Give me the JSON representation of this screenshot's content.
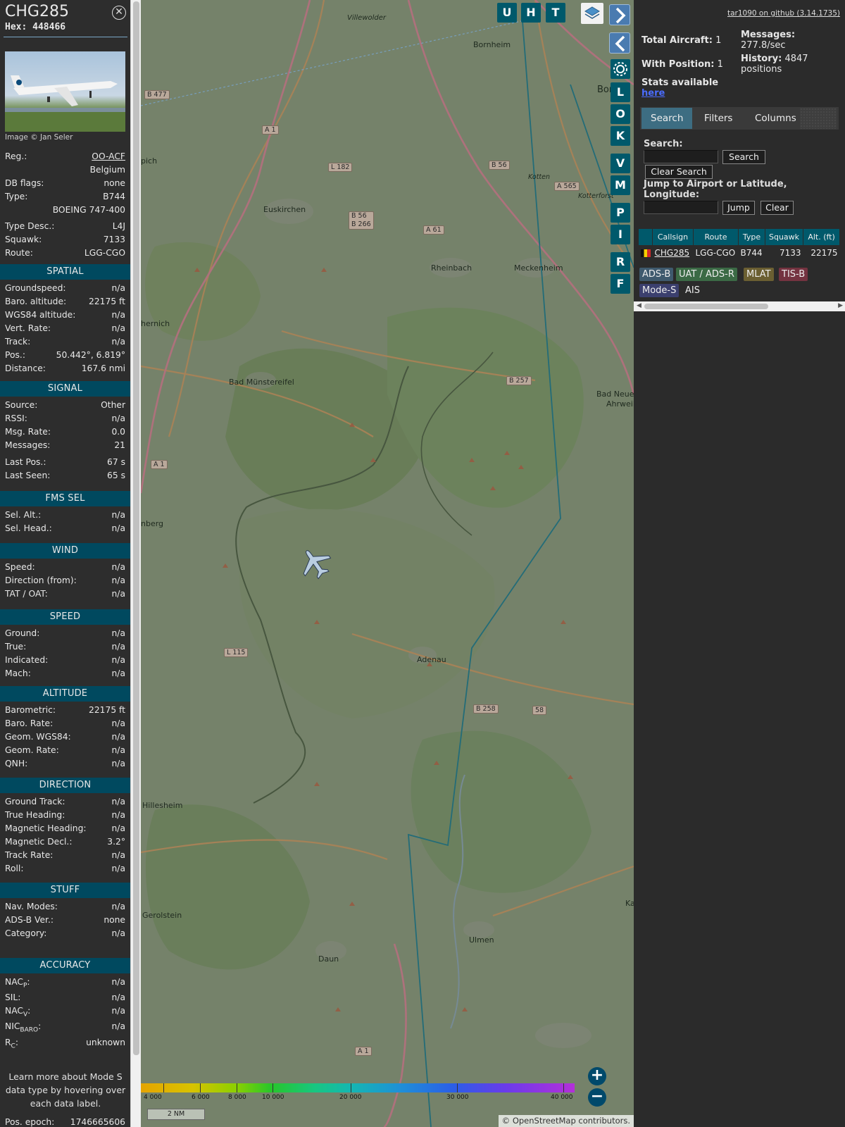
{
  "aircraft": {
    "callsign": "CHG285",
    "hex_label": "Hex:",
    "hex": "448466",
    "image_credit": "Image © Jan Seler"
  },
  "details": [
    {
      "label": "Reg.:",
      "value": "OO-ACF"
    },
    {
      "label": "",
      "value": "Belgium"
    },
    {
      "label": "DB flags:",
      "value": "none"
    },
    {
      "label": "Type:",
      "value": "B744"
    },
    {
      "label": "",
      "value": "BOEING 747-400"
    },
    {
      "label": "Type Desc.:",
      "value": "L4J"
    },
    {
      "label": "Squawk:",
      "value": "7133"
    },
    {
      "label": "Route:",
      "value": "LGG-CGO"
    }
  ],
  "sections": [
    {
      "title": "SPATIAL",
      "rows": [
        {
          "label": "Groundspeed:",
          "value": "n/a"
        },
        {
          "label": "Baro. altitude:",
          "value": "22175 ft"
        },
        {
          "label": "WGS84 altitude:",
          "value": "n/a"
        },
        {
          "label": "Vert. Rate:",
          "value": "n/a"
        },
        {
          "label": "Track:",
          "value": "n/a"
        },
        {
          "label": "Pos.:",
          "value": "50.442°, 6.819°"
        },
        {
          "label": "Distance:",
          "value": "167.6 nmi"
        }
      ]
    },
    {
      "title": "SIGNAL",
      "rows": [
        {
          "label": "Source:",
          "value": "Other"
        },
        {
          "label": "RSSI:",
          "value": "n/a"
        },
        {
          "label": "Msg. Rate:",
          "value": "0.0"
        },
        {
          "label": "Messages:",
          "value": "21"
        },
        {
          "label": "Last Pos.:",
          "value": "67 s"
        },
        {
          "label": "Last Seen:",
          "value": "65 s"
        }
      ]
    },
    {
      "title": "FMS SEL",
      "rows": [
        {
          "label": "Sel. Alt.:",
          "value": "n/a"
        },
        {
          "label": "Sel. Head.:",
          "value": "n/a"
        }
      ]
    },
    {
      "title": "WIND",
      "rows": [
        {
          "label": "Speed:",
          "value": "n/a"
        },
        {
          "label": "Direction (from):",
          "value": "n/a"
        },
        {
          "label": "TAT / OAT:",
          "value": "n/a"
        }
      ]
    },
    {
      "title": "SPEED",
      "rows": [
        {
          "label": "Ground:",
          "value": "n/a"
        },
        {
          "label": "True:",
          "value": "n/a"
        },
        {
          "label": "Indicated:",
          "value": "n/a"
        },
        {
          "label": "Mach:",
          "value": "n/a"
        }
      ]
    },
    {
      "title": "ALTITUDE",
      "rows": [
        {
          "label": "Barometric:",
          "value": "22175 ft"
        },
        {
          "label": "Baro. Rate:",
          "value": "n/a"
        },
        {
          "label": "Geom. WGS84:",
          "value": "n/a"
        },
        {
          "label": "Geom. Rate:",
          "value": "n/a"
        },
        {
          "label": "QNH:",
          "value": "n/a"
        }
      ]
    },
    {
      "title": "DIRECTION",
      "rows": [
        {
          "label": "Ground Track:",
          "value": "n/a"
        },
        {
          "label": "True Heading:",
          "value": "n/a"
        },
        {
          "label": "Magnetic Heading:",
          "value": "n/a"
        },
        {
          "label": "Magnetic Decl.:",
          "value": "3.2°"
        },
        {
          "label": "Track Rate:",
          "value": "n/a"
        },
        {
          "label": "Roll:",
          "value": "n/a"
        }
      ]
    },
    {
      "title": "STUFF",
      "rows": [
        {
          "label": "Nav. Modes:",
          "value": "n/a"
        },
        {
          "label": "ADS-B Ver.:",
          "value": "none"
        },
        {
          "label": "Category:",
          "value": "n/a"
        }
      ]
    },
    {
      "title": "ACCURACY",
      "rows": [
        {
          "label": "NAC",
          "sub": "P",
          "value": "n/a"
        },
        {
          "label": "SIL:",
          "value": "n/a"
        },
        {
          "label": "NAC",
          "sub": "V",
          "value": "n/a"
        },
        {
          "label": "NIC",
          "sub": "BARO",
          "value": "n/a"
        },
        {
          "label": "R",
          "sub": "C",
          "value": "unknown"
        }
      ]
    }
  ],
  "help_note": "Learn more about Mode S data type by hovering over each data label.",
  "pos_epoch": {
    "label": "Pos. epoch:",
    "value": "1746665606"
  },
  "map": {
    "towns": [
      "Villewolder",
      "Bornheim",
      "Bon",
      "Euskirchen",
      "Rheinbach",
      "Meckenheim",
      "Bad Münstereifel",
      "Bad Neuen",
      "Ahrweil",
      "Adenau",
      "Hillesheim",
      "Gerolstein",
      "Daun",
      "Ulmen",
      "Kotterforst",
      "Kotten",
      "pich",
      "hernich",
      "nberg",
      "Ka"
    ],
    "road_signs": [
      "B 477",
      "A 1",
      "L 182",
      "B 56",
      "B 56\nB 266",
      "A 565",
      "A 61",
      "B 257",
      "A 1",
      "L 115",
      "B 258",
      "58",
      "A 1"
    ],
    "controls": [
      "U",
      "H",
      "T",
      "L",
      "O",
      "K",
      "V",
      "M",
      "P",
      "I",
      "R",
      "F"
    ],
    "color_scale": [
      "4 000",
      "6 000",
      "8 000",
      "10 000",
      "20 000",
      "30 000",
      "40 000"
    ],
    "scale": "2 NM",
    "attribution": "© OpenStreetMap contributors."
  },
  "panel": {
    "github": "tar1090 on github (3.14.1735)",
    "total_aircraft_label": "Total Aircraft:",
    "total_aircraft": "1",
    "with_position_label": "With Position:",
    "with_position": "1",
    "messages_label": "Messages:",
    "messages_rate": "277.8/sec",
    "history_label": "History:",
    "history_value": "4847",
    "history_unit": "positions",
    "stats_text": "Stats available",
    "stats_link": "here",
    "tabs": [
      "Search",
      "Filters",
      "Columns"
    ],
    "search_label": "Search:",
    "search_button": "Search",
    "clear_search_button": "Clear Search",
    "jump_label": "Jump to Airport or Latitude, Longitude:",
    "jump_button": "Jump",
    "clear_button": "Clear",
    "table": {
      "headers": [
        "",
        "Callsign",
        "Route",
        "Type",
        "Squawk",
        "Alt. (ft)"
      ],
      "rows": [
        {
          "callsign": "CHG285",
          "route": "LGG-CGO",
          "type": "B744",
          "squawk": "7133",
          "alt": "22175"
        }
      ]
    },
    "sources": [
      {
        "label": "ADS-B",
        "color": "#3f5a6e"
      },
      {
        "label": "UAT / ADS-R",
        "color": "#3b6a45"
      },
      {
        "label": "MLAT",
        "color": "#6b5f32"
      },
      {
        "label": "TIS-B",
        "color": "#743340"
      },
      {
        "label": "Mode-S",
        "color": "#3b3f6e"
      },
      {
        "label": "AIS",
        "color": "#2b2b2b"
      }
    ]
  }
}
